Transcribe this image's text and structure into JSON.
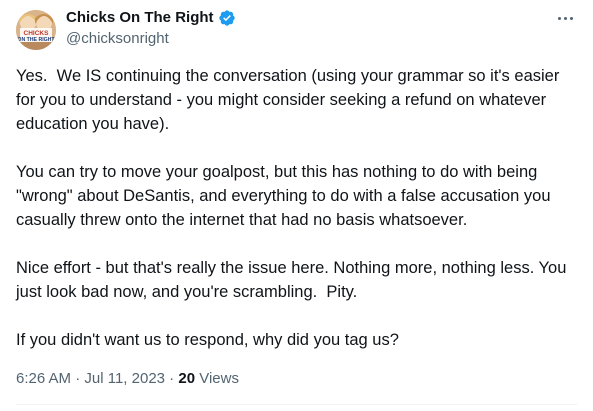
{
  "author": {
    "display_name": "Chicks On The Right",
    "handle": "@chicksonright",
    "avatar_text": "CHICKS ON THE RIGHT",
    "verified_icon": "verified-badge-icon",
    "verified_color": "#1d9bf0"
  },
  "tweet": {
    "paragraphs": [
      "Yes.  We IS continuing the conversation (using your grammar so it's easier for you to understand - you might consider seeking a refund on whatever education you have).",
      "You can try to move your goalpost, but this has nothing to do with being \"wrong\" about DeSantis, and everything to do with a false accusation you casually threw onto the internet that had no basis whatsoever.",
      "Nice effort - but that's really the issue here. Nothing more, nothing less. You just look bad now, and you're scrambling.  Pity.",
      "If you didn't want us to respond, why did you tag us?"
    ],
    "time": "6:26 AM",
    "separator": " · ",
    "date": "Jul 11, 2023",
    "views_count": "20",
    "views_label": " Views"
  },
  "icons": {
    "more": "more-options-icon"
  }
}
